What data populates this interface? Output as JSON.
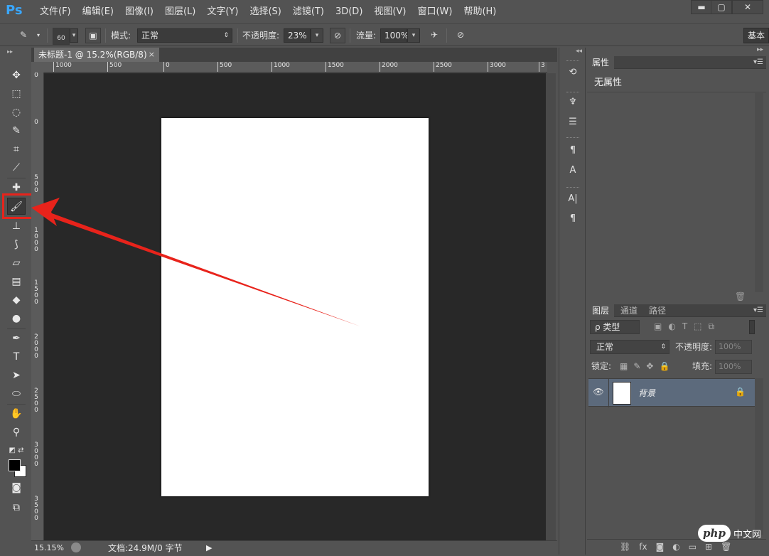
{
  "app": {
    "logo": "Ps"
  },
  "menu": [
    "文件(F)",
    "编辑(E)",
    "图像(I)",
    "图层(L)",
    "文字(Y)",
    "选择(S)",
    "滤镜(T)",
    "3D(D)",
    "视图(V)",
    "窗口(W)",
    "帮助(H)"
  ],
  "window_controls": {
    "minimize": "▬",
    "maximize": "▢",
    "close": "✕"
  },
  "options": {
    "brush_size": "60",
    "mode_label": "模式:",
    "mode_value": "正常",
    "opacity_label": "不透明度:",
    "opacity_value": "23%",
    "flow_label": "流量:",
    "flow_value": "100%",
    "workspace": "基本"
  },
  "document": {
    "tab_title": "未标题-1 @ 15.2%(RGB/8)",
    "tab_close": "×",
    "ruler_h": [
      "1000",
      "500",
      "0",
      "500",
      "1000",
      "1500",
      "2000",
      "2500",
      "3000",
      "3"
    ],
    "ruler_v": [
      "0",
      "0",
      "5\n0\n0",
      "1\n0\n0\n0",
      "1\n5\n0\n0",
      "2\n0\n0\n0",
      "2\n5\n0\n0",
      "3\n0\n0\n0",
      "3\n5\n0\n0"
    ]
  },
  "status": {
    "zoom": "15.15%",
    "docinfo": "文档:24.9M/0 字节"
  },
  "properties": {
    "tab": "属性",
    "empty": "无属性"
  },
  "layers": {
    "tabs": [
      "图层",
      "通道",
      "路径"
    ],
    "filter": "ρ 类型",
    "blend": "正常",
    "opacity_label": "不透明度:",
    "opacity_value": "100%",
    "lock_label": "锁定:",
    "fill_label": "填充:",
    "fill_value": "100%",
    "layer_name": "背景"
  },
  "watermark": {
    "logo": "php",
    "text": "中文网"
  },
  "colors": {
    "accent_red": "#e8231b",
    "ps_blue": "#3aa7ff"
  }
}
